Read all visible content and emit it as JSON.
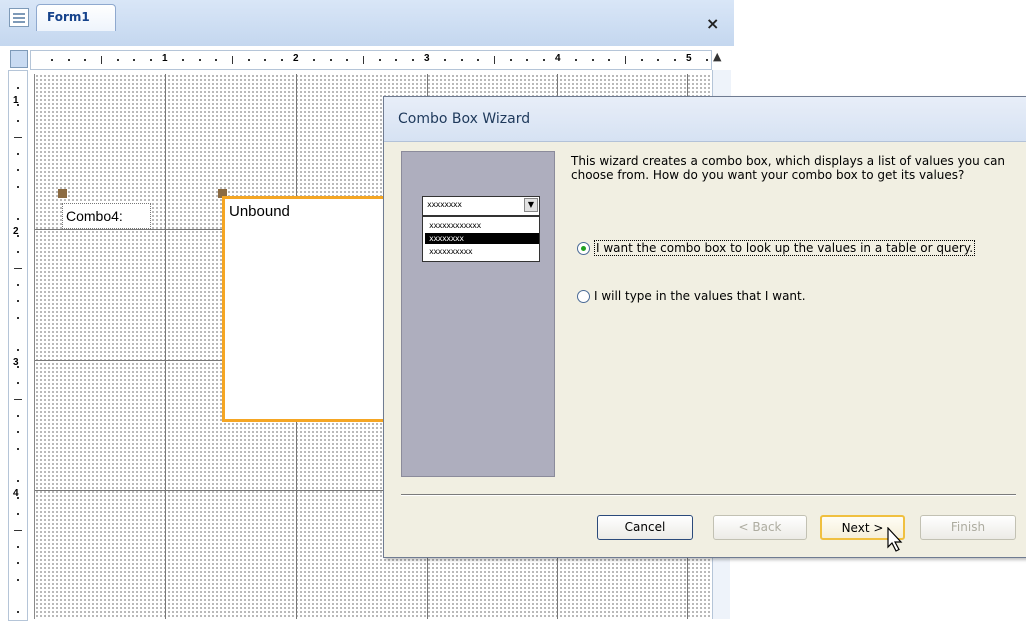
{
  "document_tab": {
    "title": "Form1",
    "close_glyph": "×"
  },
  "ruler": {
    "horizontal_numbers": [
      "1",
      "2",
      "3",
      "4",
      "5"
    ],
    "vertical_numbers": [
      "1",
      "2",
      "3",
      "4"
    ]
  },
  "form": {
    "combo_label": "Combo4:",
    "combo_control_text": "Unbound",
    "accent_color": "#f5a623"
  },
  "wizard": {
    "title": "Combo Box Wizard",
    "intro": "This wizard creates a combo box, which displays a list of values you can choose from.  How do you want your combo box to get its values?",
    "illustration": {
      "combo_value": "xxxxxxxx",
      "list_items": [
        "xxxxxxxxxxxx",
        "xxxxxxxx",
        "xxxxxxxxxx"
      ],
      "selected_index": 1
    },
    "options": [
      {
        "label": "I want the combo box to look up the values in a table or query.",
        "checked": true
      },
      {
        "label": "I will type in the values that I want.",
        "checked": false
      }
    ],
    "buttons": {
      "cancel": "Cancel",
      "back": "< Back",
      "next": "Next >",
      "finish": "Finish"
    }
  }
}
